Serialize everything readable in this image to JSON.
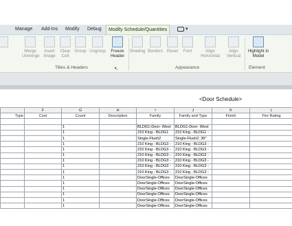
{
  "tabs": [
    "Manage",
    "Add-Ins",
    "Modify",
    "Debug",
    "Modify Schedule/Quantities"
  ],
  "tab_extra_label": "▾",
  "ribbon": {
    "buttons": [
      {
        "label": "Merge Unmerge"
      },
      {
        "label": "Insert Image"
      },
      {
        "label": "Clear Cell"
      },
      {
        "label": "Group"
      },
      {
        "label": "Ungroup"
      },
      {
        "label": "Freeze Header"
      },
      {
        "label": "Shading"
      },
      {
        "label": "Borders"
      },
      {
        "label": "Reset"
      },
      {
        "label": "Font"
      },
      {
        "label": "Align Horizontal"
      },
      {
        "label": "Align Vertical"
      },
      {
        "label": "Highlight in Model"
      }
    ],
    "groups": [
      "Titles & Headers",
      "Appearance",
      "Element"
    ]
  },
  "schedule": {
    "title": "<Door Schedule>",
    "letters": [
      "",
      "F",
      "G",
      "H",
      "I",
      "J",
      "K",
      "L"
    ],
    "headers": [
      "Type",
      "Cost",
      "Count",
      "Description",
      "Family",
      "Family and Type",
      "Finish",
      "Fire Rating"
    ],
    "rows": [
      [
        "",
        "",
        "",
        "",
        "",
        "",
        "",
        ""
      ],
      [
        "",
        "",
        "1",
        "",
        "BLDG1-Door- West",
        "BLDG1-Door- West",
        "",
        ""
      ],
      [
        "",
        "",
        "1",
        "",
        "210 King - BLDG1",
        "210 King - BLDG1 -",
        "",
        ""
      ],
      [
        "",
        "",
        "1",
        "",
        "Single-Flush2",
        "Single-Flush2: 36\"",
        "",
        ""
      ],
      [
        "",
        "",
        "1",
        "",
        "210 King - BLDG3 -",
        "210 King - BLDG3 -",
        "",
        ""
      ],
      [
        "",
        "",
        "1",
        "",
        "210 King - BLDG3 -",
        "210 King - BLDG3 -",
        "",
        ""
      ],
      [
        "",
        "",
        "1",
        "",
        "210 King - BLDG3 -",
        "210 King - BLDG3 -",
        "",
        ""
      ],
      [
        "",
        "",
        "1",
        "",
        "210 King - BLDG3 -",
        "210 King - BLDG3 -",
        "",
        ""
      ],
      [
        "",
        "",
        "1",
        "",
        "210 King - BLDG3 -",
        "210 King - BLDG3 -",
        "",
        ""
      ],
      [
        "",
        "",
        "1",
        "",
        "210 King - BLDG3 -",
        "210 King - BLDG3 -",
        "",
        ""
      ],
      [
        "",
        "",
        "1",
        "",
        "DoorSingle-Offices",
        "DoorSingle-Offices",
        "",
        ""
      ],
      [
        "",
        "",
        "1",
        "",
        "DoorSingle-Offices",
        "DoorSingle-Offices",
        "",
        ""
      ],
      [
        "",
        "",
        "1",
        "",
        "DoorSingle-Offices",
        "DoorSingle-Offices",
        "",
        ""
      ],
      [
        "",
        "",
        "1",
        "",
        "DoorSingle-Offices",
        "DoorSingle-Offices",
        "",
        ""
      ],
      [
        "",
        "",
        "1",
        "",
        "DoorSingle-Offices",
        "DoorSingle-Offices",
        "",
        ""
      ],
      [
        "",
        "",
        "1",
        "",
        "DoorSingle-Offices",
        "DoorSingle-Offices",
        "",
        ""
      ]
    ]
  }
}
